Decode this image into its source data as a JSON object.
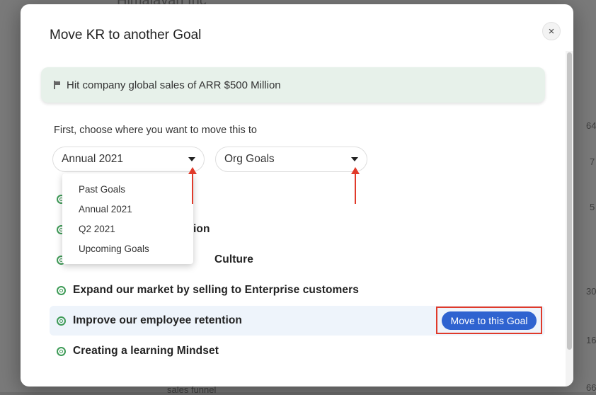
{
  "background": {
    "title_fragment": "Himalayan Inc",
    "side_numbers": [
      "64",
      "7",
      "5",
      "30",
      "16",
      "66"
    ],
    "bottom_text": "sales funnel"
  },
  "modal": {
    "title": "Move KR to another Goal",
    "close_glyph": "×",
    "key_result": "Hit company global sales of ARR $500 Million",
    "instructions": "First, choose where you want to move this to",
    "period_select": {
      "value": "Annual 2021"
    },
    "scope_select": {
      "value": "Org Goals"
    },
    "period_options": [
      "Past Goals",
      "Annual 2021",
      "Q2 2021",
      "Upcoming Goals"
    ],
    "goals": [
      {
        "label": ""
      },
      {
        "label": "ion"
      },
      {
        "label": "Culture"
      },
      {
        "label": "Expand our market by selling to Enterprise customers"
      },
      {
        "label": "Improve our employee retention"
      },
      {
        "label": "Creating a learning Mindset"
      }
    ],
    "move_button": "Move to this Goal"
  },
  "colors": {
    "accent": "#2f63d0",
    "annotation": "#e03a2a",
    "goal_icon": "#3e9b57",
    "kr_background": "#e7f1ea"
  },
  "icons": {
    "flag": "flag-icon",
    "goal": "target-icon",
    "close": "close-icon",
    "caret": "caret-down-icon"
  }
}
